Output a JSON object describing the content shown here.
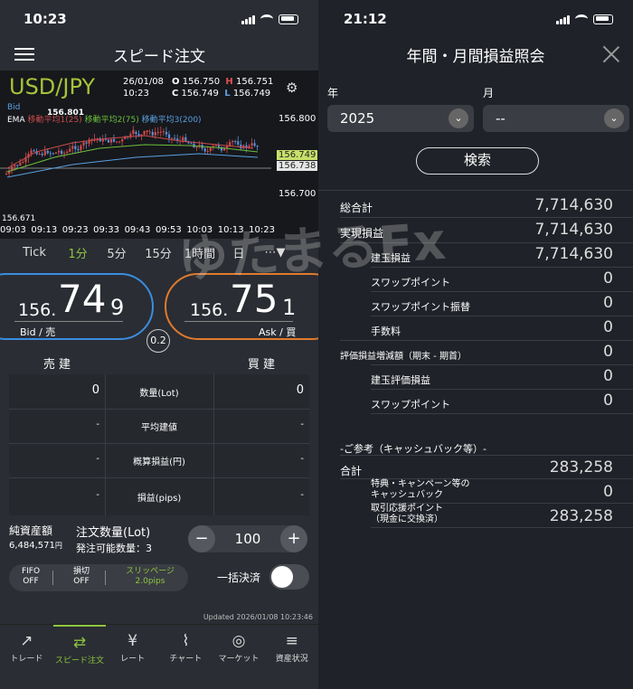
{
  "left": {
    "status_time": "10:23",
    "title": "スピード注文",
    "chart": {
      "pair": "USD/JPY",
      "date": "26/01/08",
      "time": "10:23",
      "open_label": "O",
      "open": "156.750",
      "high_label": "H",
      "high": "156.751",
      "close_label": "C",
      "close": "156.749",
      "low_label": "L",
      "low": "156.749",
      "bid_label": "Bid",
      "ema_label": "EMA",
      "ma1": "移動平均1(25)",
      "ma2": "移動平均2(75)",
      "ma3": "移動平均3(200)",
      "high_marker": "156.801",
      "low_marker": "156.671",
      "y_ticks": [
        "156.800",
        "156.700"
      ],
      "current_price": "156.749",
      "line_price": "156.738",
      "x_ticks": [
        "09:03",
        "09:13",
        "09:23",
        "09:33",
        "09:43",
        "09:53",
        "10:03",
        "10:13",
        "10:23"
      ]
    },
    "timeframes": [
      "Tick",
      "1分",
      "5分",
      "15分",
      "1時間",
      "日",
      "⋯▼"
    ],
    "bid": {
      "prefix": "156.",
      "big": "74",
      "last": "9",
      "label": "Bid / 売"
    },
    "ask": {
      "prefix": "156.",
      "big": "75",
      "last": "1",
      "label": "Ask / 買"
    },
    "spread": "0.2",
    "sell_header": "売 建",
    "buy_header": "買 建",
    "rows": [
      {
        "label": "数量(Lot)",
        "sell": "0",
        "buy": "0"
      },
      {
        "label": "平均建値",
        "sell": "-",
        "buy": "-"
      },
      {
        "label": "概算損益(円)",
        "sell": "-",
        "buy": "-"
      },
      {
        "label": "損益(pips)",
        "sell": "-",
        "buy": "-"
      }
    ],
    "net_assets_label": "純資産額",
    "net_assets": "6,484,571",
    "yen": "円",
    "order_qty_label": "注文数量(Lot)",
    "order_available": "発注可能数量：3",
    "qty": "100",
    "minus": "−",
    "plus": "+",
    "fifo": "FIFO",
    "fifo_val": "OFF",
    "teiki": "損切",
    "teiki_val": "OFF",
    "slippage": "スリッページ",
    "slippage_val": "2.0pips",
    "bulk_label": "一括決済",
    "updated": "Updated 2026/01/08 10:23:46",
    "nav": [
      "トレード",
      "スピード注文",
      "レート",
      "チャート",
      "マーケット",
      "資産状況"
    ],
    "nav_icons": [
      "trade-icon",
      "speed-order-icon",
      "rate-icon",
      "chart-icon",
      "market-icon",
      "assets-icon"
    ],
    "colors": {
      "accent": "#8dc63f",
      "bid_ring": "#3a8de0",
      "ask_ring": "#e07a2e",
      "sell_line": "#3a8de0",
      "buy_line": "#d04a4a"
    }
  },
  "right": {
    "status_time": "21:12",
    "title": "年間・月間損益照会",
    "year_label": "年",
    "month_label": "月",
    "year": "2025",
    "month": "--",
    "search": "検索",
    "watermark": "ゆたまるFx",
    "rows": [
      {
        "label": "総合計",
        "value": "7,714,630"
      },
      {
        "label": "実現損益",
        "value": "7,714,630"
      },
      {
        "label": "建玉損益",
        "value": "7,714,630"
      },
      {
        "label": "スワップポイント",
        "value": "0"
      },
      {
        "label": "スワップポイント振替",
        "value": "0"
      },
      {
        "label": "手数料",
        "value": "0"
      },
      {
        "label": "評価損益増減額（期末 - 期首）",
        "value": "0"
      },
      {
        "label": "建玉評価損益",
        "value": "0"
      },
      {
        "label": "スワップポイント",
        "value": "0"
      }
    ],
    "reference_label": "-ご参考（キャッシュバック等）-",
    "ref_rows": [
      {
        "label": "合計",
        "value": "283,258"
      },
      {
        "label1": "特典・キャンペーン等の",
        "label2": "キャッシュバック",
        "value": "0"
      },
      {
        "label1": "取引応援ポイント",
        "label2": "（現金に交換済）",
        "value": "283,258"
      }
    ]
  }
}
